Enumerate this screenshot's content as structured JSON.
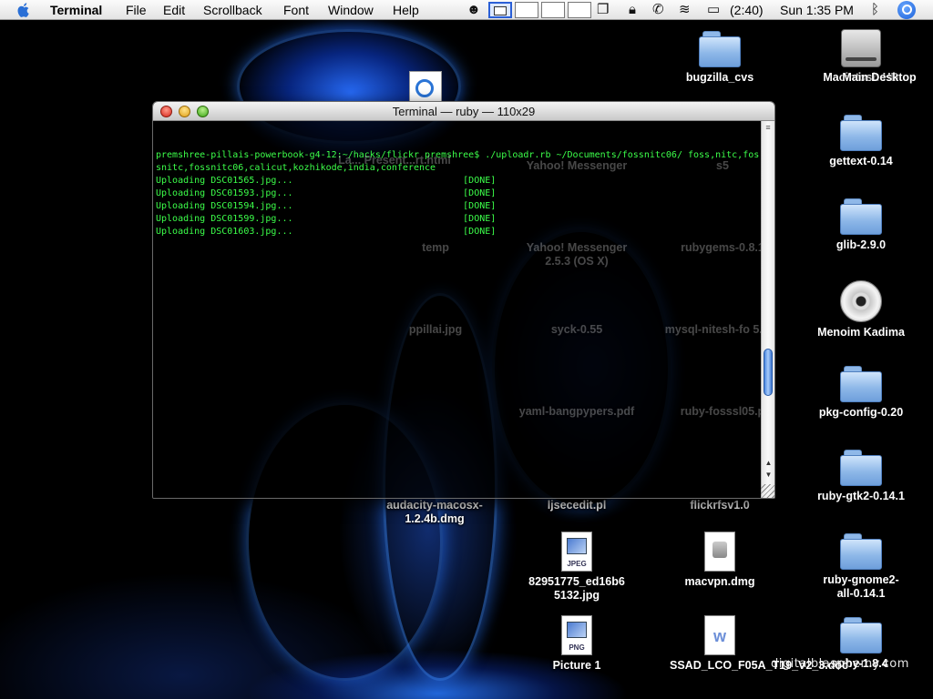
{
  "menubar": {
    "app_name": "Terminal",
    "items": [
      "File",
      "Edit",
      "Scrollback",
      "Font",
      "Window",
      "Help"
    ],
    "battery": "(2:40)",
    "clock": "Sun 1:35 PM"
  },
  "terminal": {
    "title": "Terminal — ruby — 110x29",
    "lines": [
      "premshree-pillais-powerbook-g4-12:~/hacks/flickr premshree$ ./uploadr.rb ~/Documents/fossnitc06/ foss,nitc,fos",
      "snitc,fossnitc06,calicut,kozhikode,india,conference",
      "Uploading DSC01565.jpg...                               [DONE]",
      "Uploading DSC01593.jpg...                               [DONE]",
      "Uploading DSC01594.jpg...                               [DONE]",
      "Uploading DSC01599.jpg...                               [DONE]",
      "Uploading DSC01603.jpg...                               [DONE]"
    ]
  },
  "desktop": {
    "right_column": [
      {
        "label": "Macintosh HD",
        "icon": "hard-disk-icon"
      },
      {
        "label": "gettext-0.14",
        "icon": "folder-icon"
      },
      {
        "label": "glib-2.9.0",
        "icon": "folder-icon"
      },
      {
        "label": "Menoim Kadima",
        "icon": "cd-icon"
      },
      {
        "label": "pkg-config-0.20",
        "icon": "folder-icon"
      },
      {
        "label": "ruby-gtk2-0.14.1",
        "icon": "folder-icon"
      },
      {
        "label": "ruby-gnome2-all-0.14.1",
        "icon": "folder-icon"
      },
      {
        "label": "ruby-1.8.4",
        "icon": "folder-icon"
      }
    ],
    "main_desktop_label": "Main Desktop",
    "bugzilla": "bugzilla_cvs",
    "audacity": "audacity-macosx-1.2.4b.dmg",
    "ljsecedit": "ljsecedit.pl",
    "flickrfsv": "flickrfsv1.0",
    "jpeg_file": "82951775_ed16b65132.jpg",
    "macvpn": "macvpn.dmg",
    "picture1": "Picture 1",
    "ssad_doc": "SSAD_LCO_F05A_T19_V2_3.doc",
    "behind_window": {
      "yahoo_messenger": "Yahoo! Messenger",
      "yahoo_messenger_osx": "Yahoo! Messenger 2.5.3 (OS X)",
      "s5": "s5",
      "temp": "temp",
      "rubygems": "rubygems-0.8.1",
      "ppillai": "ppillai.jpg",
      "syck": "syck-0.55",
      "mysql": "mysql-nitesh-fo 5.pdf",
      "yaml": "yaml-bangpypers.pdf",
      "rubyfosss": "ruby-fosssl05.p",
      "latest_present": "La... Present...rt.html"
    },
    "watermark": "digitalblasphemy.com"
  },
  "colors": {
    "terminal_text": "#3cff4a",
    "terminal_bg": "#000000",
    "menubar_bg": "#f0f0f0"
  }
}
